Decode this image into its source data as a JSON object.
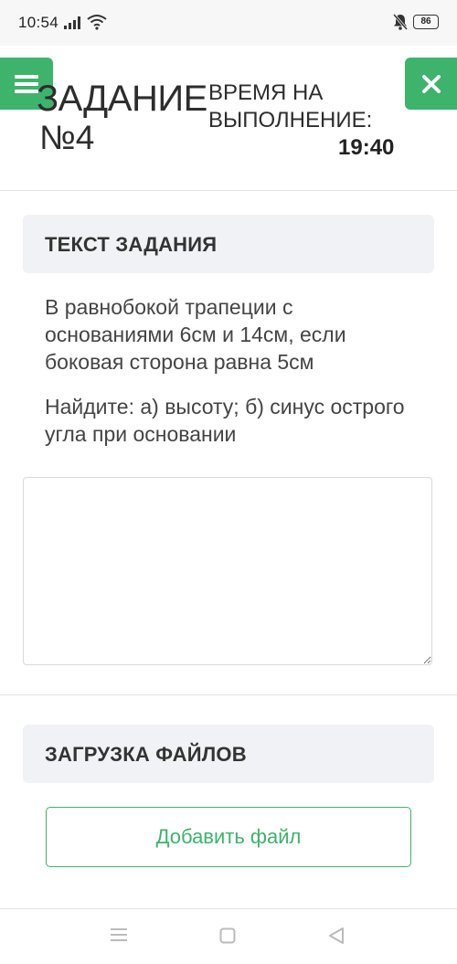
{
  "status_bar": {
    "time": "10:54",
    "battery": "86"
  },
  "header": {
    "title": "ЗАДАНИЕ",
    "number": "№4",
    "time_label": "ВРЕМЯ НА ВЫПОЛНЕНИЕ:",
    "time_value": "19:40"
  },
  "task": {
    "section_title": "ТЕКСТ ЗАДАНИЯ",
    "paragraph1": "В равнобокой трапеции с основаниями 6см и 14см, если боковая сторона равна 5см",
    "paragraph2": "Найдите: а) высоту; б) синус острого угла при основании",
    "answer_value": ""
  },
  "upload": {
    "section_title": "ЗАГРУЗКА ФАЙЛОВ",
    "add_file_label": "Добавить файл"
  },
  "colors": {
    "accent": "#3db36b",
    "section_bg": "#f1f2f6"
  }
}
